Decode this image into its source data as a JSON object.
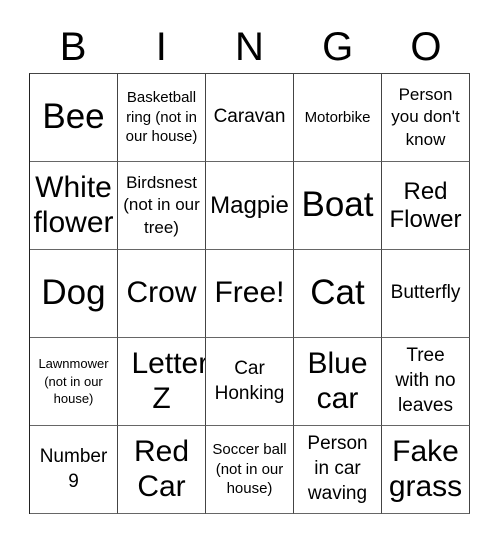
{
  "header": [
    "B",
    "I",
    "N",
    "G",
    "O"
  ],
  "cells": [
    [
      "Bee",
      "Basketball ring (not in our house)",
      "Caravan",
      "Motorbike",
      "Person you don't know"
    ],
    [
      "White flower",
      "Birdsnest (not in our tree)",
      "Magpie",
      "Boat",
      "Red Flower"
    ],
    [
      "Dog",
      "Crow",
      "Free!",
      "Cat",
      "Butterfly"
    ],
    [
      "Lawnmower (not in our house)",
      "Letter Z",
      "Car Honking",
      "Blue car",
      "Tree with no leaves"
    ],
    [
      "Number 9",
      "Red Car",
      "Soccer ball (not in our house)",
      "Person in car waving",
      "Fake grass"
    ]
  ]
}
